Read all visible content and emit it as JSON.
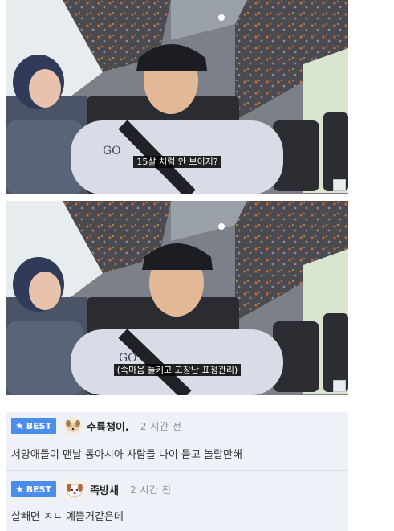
{
  "frames": [
    {
      "subtitle": "15살 처럼 안 보이지?",
      "shirt_text": "GO"
    },
    {
      "subtitle": "(속마음 들키고 고장난 표정관리)",
      "shirt_text": "GO"
    }
  ],
  "comments": [
    {
      "badge": "BEST",
      "nickname": "수륙챙이.",
      "time": "2 시간 전",
      "text": "서양애들이 맨날 동아시아 사람들 나이 듣고 놀랄만해"
    },
    {
      "badge": "BEST",
      "nickname": "족방새",
      "time": "2 시간 전",
      "text": "살빼면 ㅈㄴ 예쁠거같은데"
    }
  ],
  "colors": {
    "best_badge": "#4b8ded",
    "comment_bg": "#eef2f8"
  }
}
